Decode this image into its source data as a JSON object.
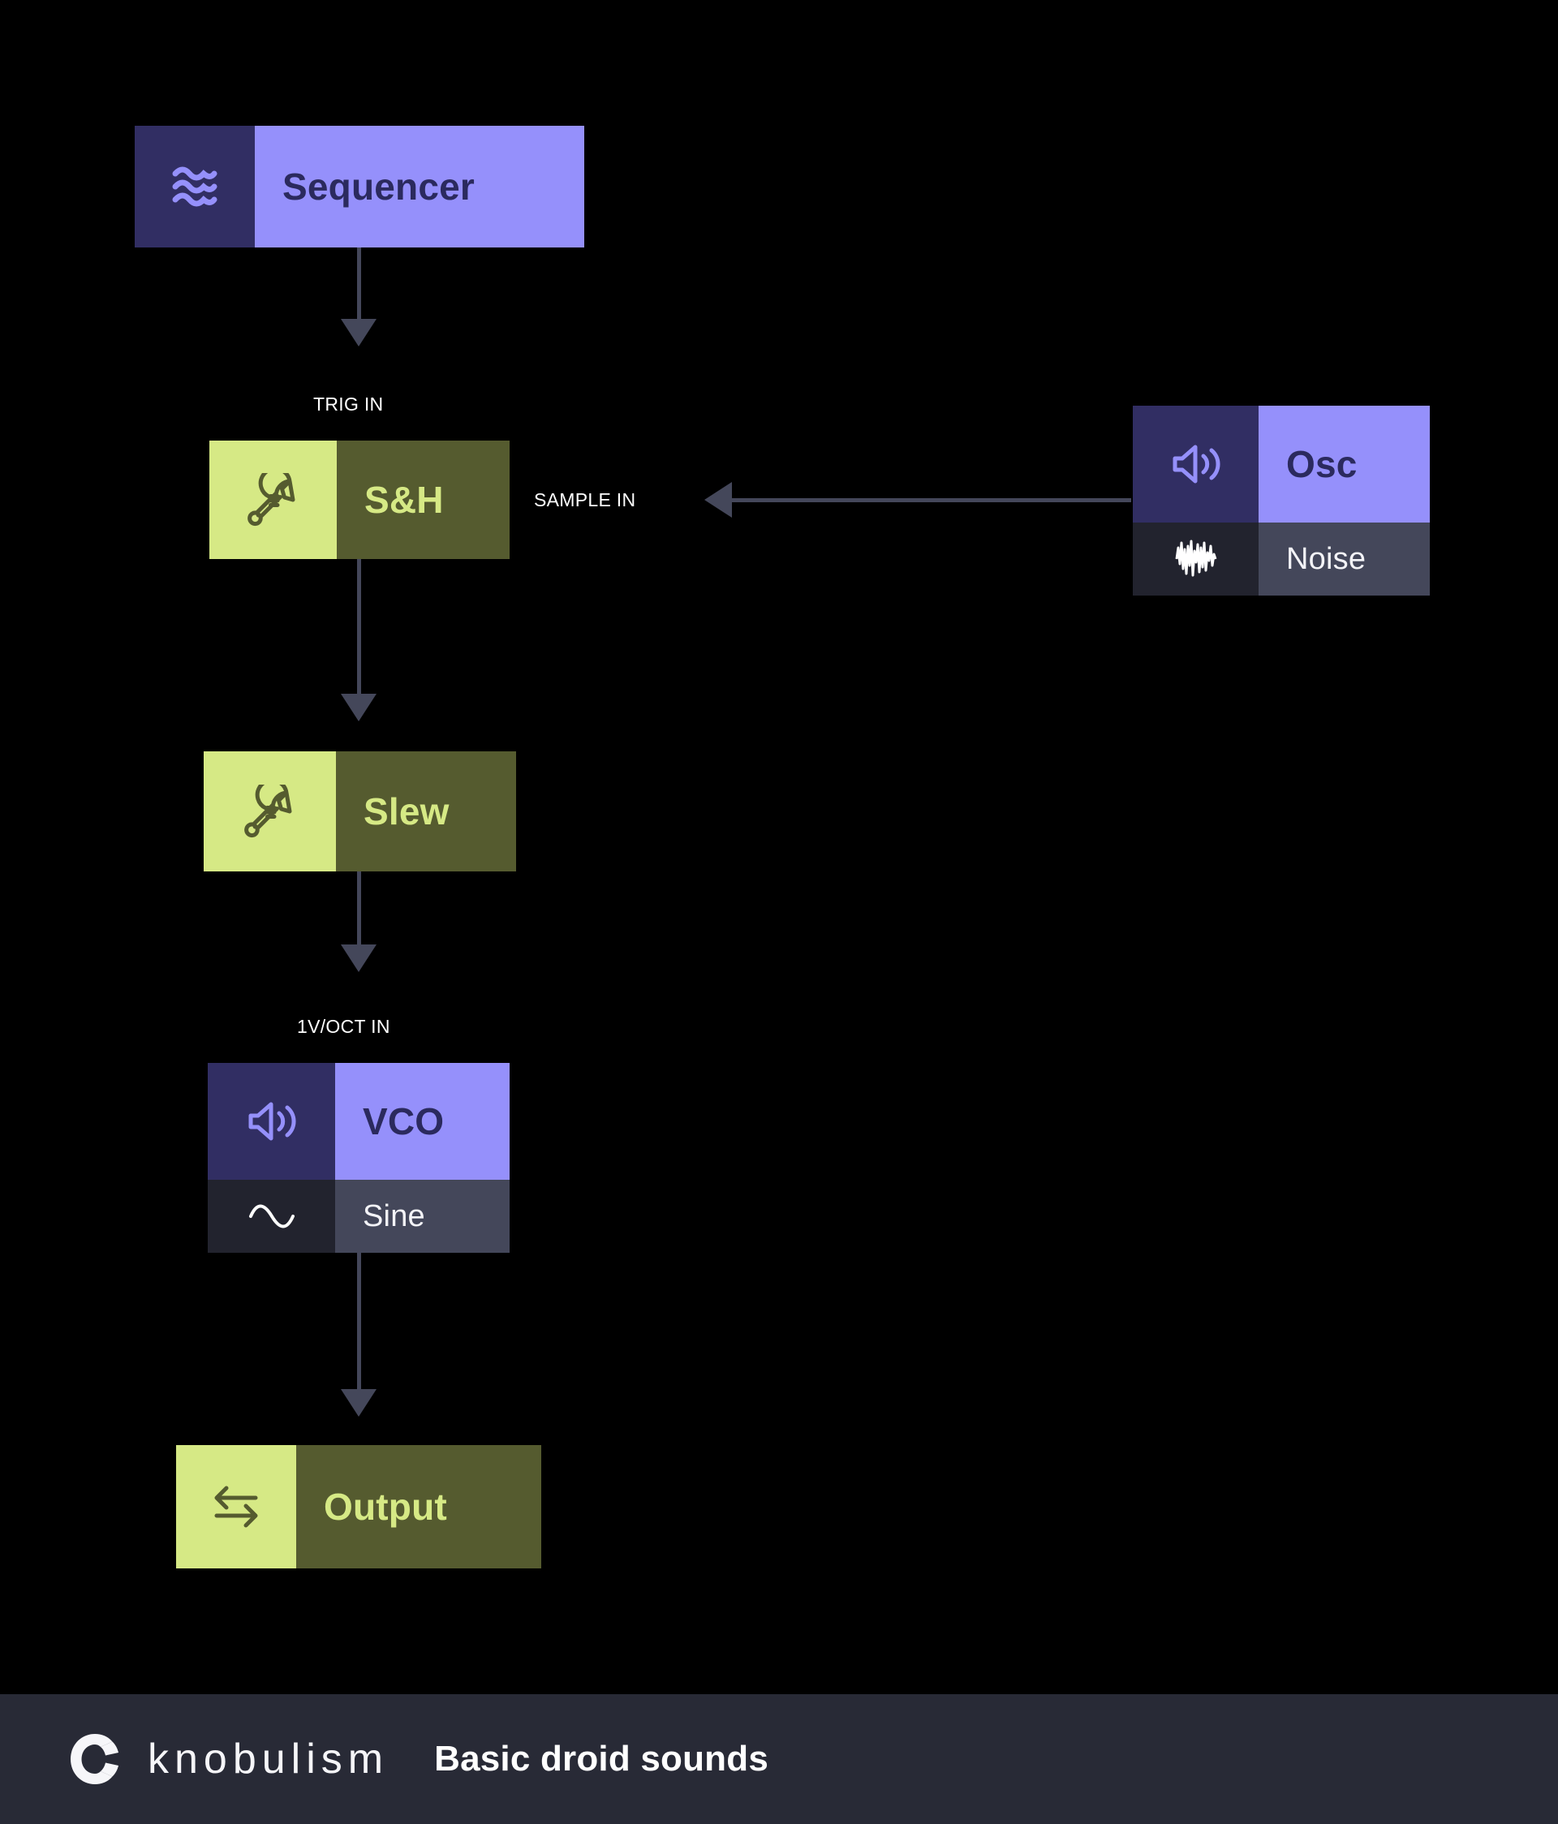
{
  "patch": {
    "background_color": "#000000",
    "accent_purple": "#9590FB",
    "accent_purple_dark": "#312E63",
    "accent_green": "#D6E985",
    "accent_green_dark": "#555B2F",
    "connector_color": "#44475A",
    "sub_row_color": "#44475A"
  },
  "modules": {
    "sequencer": {
      "label": "Sequencer",
      "icon": "waves-icon"
    },
    "sample_and_hold": {
      "label": "S&H",
      "icon": "wrench-icon"
    },
    "slew": {
      "label": "Slew",
      "icon": "wrench-icon"
    },
    "vco": {
      "label": "VCO",
      "icon": "speaker-icon",
      "sub_label": "Sine",
      "sub_icon": "sine-wave-icon"
    },
    "osc": {
      "label": "Osc",
      "icon": "speaker-icon",
      "sub_label": "Noise",
      "sub_icon": "noise-wave-icon"
    },
    "output": {
      "label": "Output",
      "icon": "exchange-arrows-icon"
    }
  },
  "connections": [
    {
      "name": "sequencer-to-sh",
      "port_label": "TRIG IN",
      "direction": "down",
      "from": "Sequencer",
      "to": "S&H"
    },
    {
      "name": "osc-to-sh",
      "port_label": "SAMPLE IN",
      "direction": "left",
      "from": "Osc",
      "to": "S&H"
    },
    {
      "name": "sh-to-slew",
      "port_label": "",
      "direction": "down",
      "from": "S&H",
      "to": "Slew"
    },
    {
      "name": "slew-to-vco",
      "port_label": "1V/OCT IN",
      "direction": "down",
      "from": "Slew",
      "to": "VCO"
    },
    {
      "name": "vco-to-output",
      "port_label": "",
      "direction": "down",
      "from": "VCO",
      "to": "Output"
    }
  ],
  "footer": {
    "brand": "knobulism",
    "title": "Basic droid sounds",
    "logo_icon": "knobulism-logo-icon",
    "background_color": "#282A36"
  }
}
